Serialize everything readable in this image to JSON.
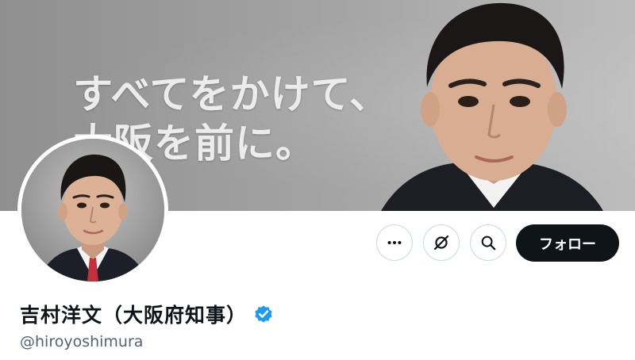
{
  "banner": {
    "slogan_line1": "すべてをかけて、",
    "slogan_line2": "大阪を前に。"
  },
  "actions": {
    "more_icon": "more-dots-icon",
    "grok_icon": "grok-icon",
    "search_icon": "search-icon",
    "follow_label": "フォロー"
  },
  "profile": {
    "display_name": "吉村洋文（大阪府知事）",
    "handle": "@hiroyoshimura",
    "verified_icon": "verified-badge-icon"
  },
  "colors": {
    "follow_button_bg": "#0f1419",
    "verified_blue": "#1d9bf0",
    "handle_gray": "#536471",
    "button_border": "#cfd9de"
  }
}
